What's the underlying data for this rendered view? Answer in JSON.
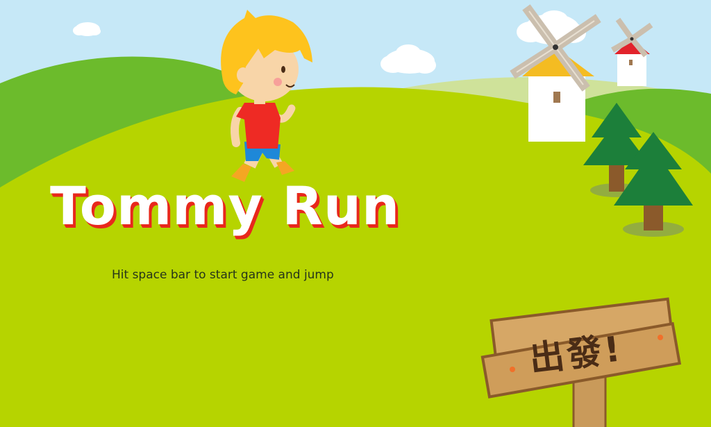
{
  "game": {
    "title": "Tommy Run",
    "instruction": "Hit space bar to start game and jump",
    "sign_text": "出發!"
  },
  "colors": {
    "sky": "#c6e8f7",
    "hill_back": "#6cbb2c",
    "field": "#b6d400",
    "title_fill": "#ffffff",
    "title_outline": "#e8281c",
    "wood": "#c99a5a",
    "tree": "#1c7f3a"
  },
  "icons": [
    "boy-character-icon",
    "windmill-icon",
    "pine-tree-icon",
    "wooden-signpost-icon",
    "cloud-icon"
  ]
}
